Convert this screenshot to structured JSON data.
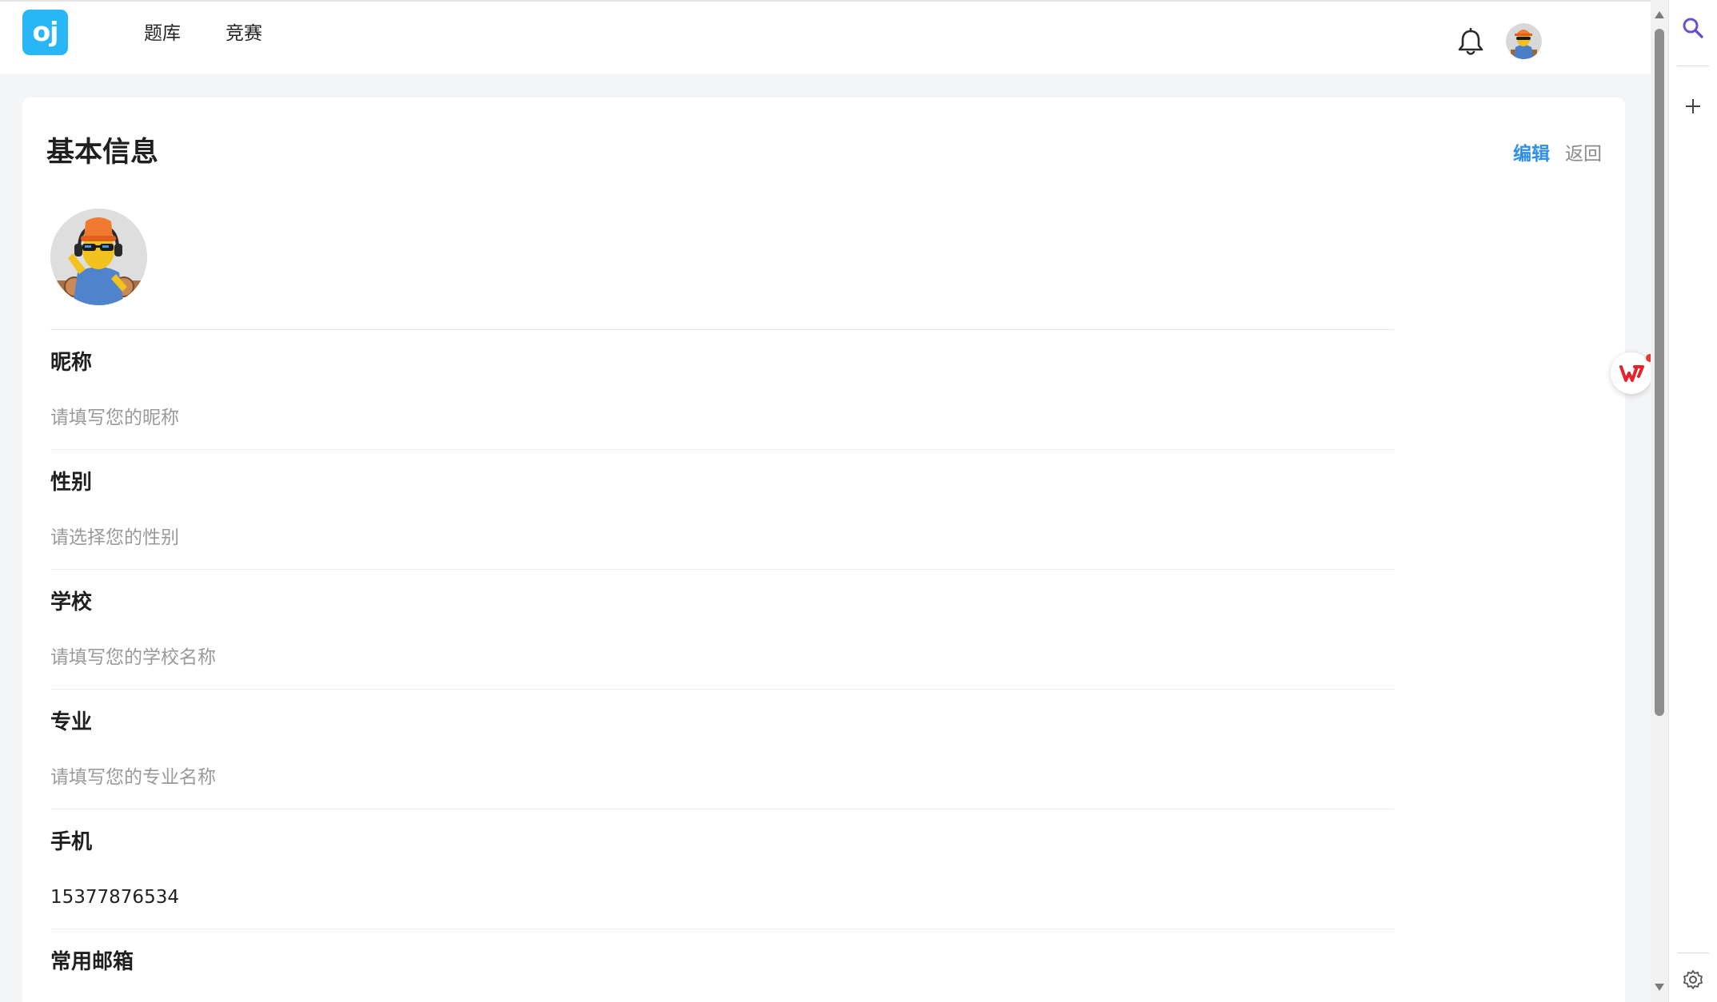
{
  "app": {
    "logo_text": "oj",
    "nav": [
      "题库",
      "竞赛"
    ]
  },
  "header_icons": {
    "notification": "bell-icon",
    "user": "avatar"
  },
  "card": {
    "title": "基本信息",
    "edit_label": "编辑",
    "back_label": "返回"
  },
  "fields": [
    {
      "label": "昵称",
      "value": "请填写您的昵称",
      "is_placeholder": true
    },
    {
      "label": "性别",
      "value": "请选择您的性别",
      "is_placeholder": true
    },
    {
      "label": "学校",
      "value": "请填写您的学校名称",
      "is_placeholder": true
    },
    {
      "label": "专业",
      "value": "请填写您的专业名称",
      "is_placeholder": true
    },
    {
      "label": "手机",
      "value": "15377876534",
      "is_placeholder": false
    },
    {
      "label": "常用邮箱",
      "value": "",
      "is_placeholder": true
    }
  ],
  "colors": {
    "accent": "#2f8fea",
    "logo": "#29b6f6",
    "page_bg": "#f4f5f7",
    "placeholder": "#9a9a9a"
  },
  "edge_sidebar": [
    "search-icon",
    "plus-icon",
    "settings-icon"
  ]
}
